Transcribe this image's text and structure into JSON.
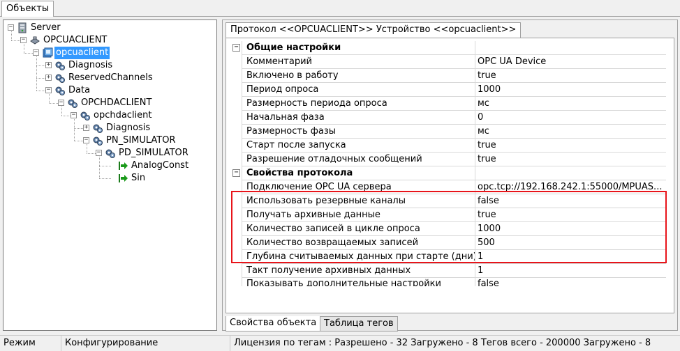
{
  "top_tab": {
    "label": "Объекты"
  },
  "tree": [
    {
      "label": "Server",
      "icon": "server-icon",
      "expander": "−"
    },
    {
      "label": "OPCUACLIENT",
      "icon": "plugin-icon",
      "expander": "−"
    },
    {
      "label": "opcuaclient",
      "icon": "device-icon",
      "expander": "−",
      "selected": true
    },
    {
      "label": "Diagnosis",
      "icon": "gears-icon",
      "expander": "+"
    },
    {
      "label": "ReservedChannels",
      "icon": "gears-icon",
      "expander": "+"
    },
    {
      "label": "Data",
      "icon": "gears-icon",
      "expander": "−"
    },
    {
      "label": "OPCHDACLIENT",
      "icon": "gears-icon",
      "expander": "−"
    },
    {
      "label": "opchdaclient",
      "icon": "gears-icon",
      "expander": "−"
    },
    {
      "label": "Diagnosis",
      "icon": "gears-icon",
      "expander": "+"
    },
    {
      "label": "PN_SIMULATOR",
      "icon": "gears-icon",
      "expander": "−"
    },
    {
      "label": "PD_SIMULATOR",
      "icon": "gears-icon",
      "expander": "−"
    },
    {
      "label": "AnalogConst",
      "icon": "tag-arrow-icon",
      "expander": ""
    },
    {
      "label": "Sin",
      "icon": "tag-arrow-icon",
      "expander": ""
    }
  ],
  "protocol_tab": {
    "label": "Протокол <<OPCUACLIENT>> Устройство <<opcuaclient>>"
  },
  "properties": [
    {
      "category": true,
      "name": "Общие настройки",
      "value": ""
    },
    {
      "name": "Комментарий",
      "value": "OPC UA Device"
    },
    {
      "name": "Включено в работу",
      "value": "true"
    },
    {
      "name": "Период опроса",
      "value": "1000"
    },
    {
      "name": "Размерность периода опроса",
      "value": "мс"
    },
    {
      "name": "Начальная фаза",
      "value": "0"
    },
    {
      "name": "Размерность фазы",
      "value": "мс"
    },
    {
      "name": "Старт после запуска",
      "value": "true"
    },
    {
      "name": "Разрешение отладочных сообщений",
      "value": "true"
    },
    {
      "category": true,
      "name": "Свойства протокола",
      "value": ""
    },
    {
      "name": "Подключение OPC UA сервера",
      "value": "opc.tcp://192.168.242.1:55000/MPUAS..."
    },
    {
      "name": "Использовать резервные каналы",
      "value": "false"
    },
    {
      "name": "Получать архивные данные",
      "value": "true"
    },
    {
      "name": "Количество записей в цикле опроса",
      "value": "1000"
    },
    {
      "name": "Количество возвращаемых записей",
      "value": "500"
    },
    {
      "name": "Глубина считываемых данных при старте (дни)",
      "value": "1"
    },
    {
      "name": "Такт получение архивных данных",
      "value": "1"
    },
    {
      "name": "Показывать дополнительные настройки",
      "value": "false",
      "cut": true
    }
  ],
  "bottom_tabs": [
    {
      "label": "Свойства объекта",
      "active": true
    },
    {
      "label": "Таблица тегов",
      "active": false
    }
  ],
  "status_bar": {
    "mode_label": "Режим",
    "mode_value": "Конфигурирование",
    "license": "Лицензия по тегам : Разрешено - 32 Загружено - 8 Тегов всего - 200000 Загружено - 8"
  },
  "colors": {
    "selection": "#3399ff",
    "highlight_box": "#e8141a",
    "tag_arrow": "#1a9a1a"
  }
}
